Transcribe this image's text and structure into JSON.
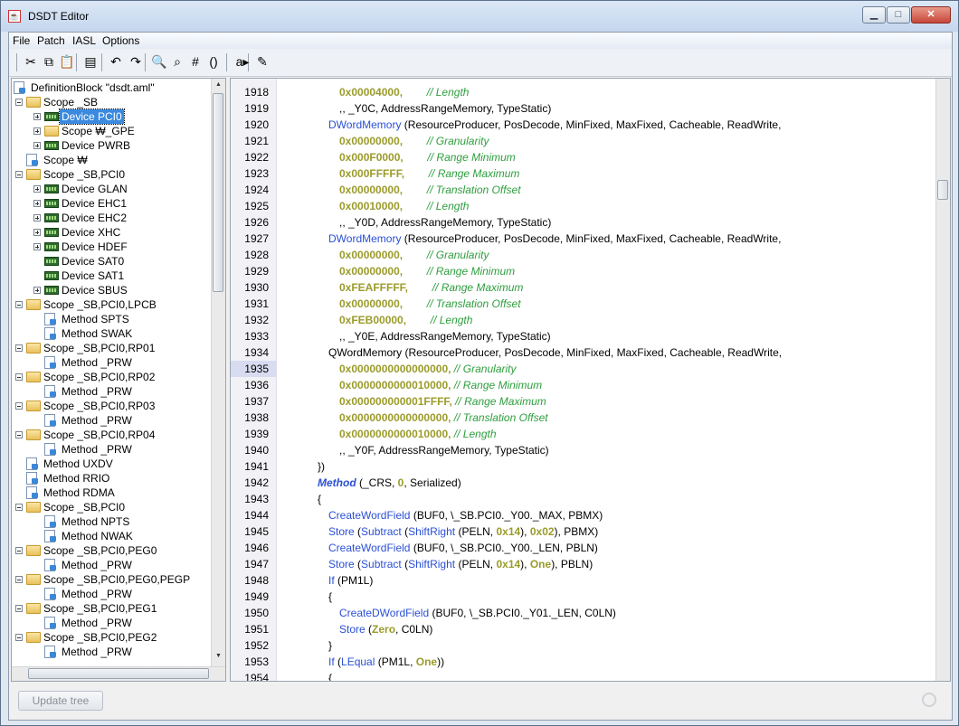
{
  "window": {
    "title": "DSDT Editor",
    "minimize": "▁",
    "maximize": "□",
    "close": "✕"
  },
  "menu": [
    "File",
    "Patch",
    "IASL",
    "Options"
  ],
  "toolbar": [
    {
      "name": "cut-icon",
      "glyph": "✂"
    },
    {
      "name": "copy-icon",
      "glyph": "⧉"
    },
    {
      "name": "paste-icon",
      "glyph": "📋"
    },
    {
      "name": "properties-icon",
      "glyph": "▤"
    },
    {
      "name": "undo-icon",
      "glyph": "↶"
    },
    {
      "name": "redo-icon",
      "glyph": "↷"
    },
    {
      "name": "find-icon",
      "glyph": "🔍"
    },
    {
      "name": "find-replace-icon",
      "glyph": "⌕"
    },
    {
      "name": "goto-line-icon",
      "glyph": "#"
    },
    {
      "name": "braces-icon",
      "glyph": "()"
    },
    {
      "name": "compile-icon",
      "glyph": "a▸"
    },
    {
      "name": "notes-icon",
      "glyph": "✎"
    }
  ],
  "tree": [
    {
      "label": "DefinitionBlock \"dsdt.aml\"",
      "depth": 0,
      "icon": "file",
      "exp": ""
    },
    {
      "label": "Scope _SB",
      "depth": 1,
      "icon": "folder",
      "exp": "minus"
    },
    {
      "label": "Device PCI0",
      "depth": 2,
      "icon": "chip",
      "exp": "plus",
      "selected": true
    },
    {
      "label": "Scope ₩_GPE",
      "depth": 2,
      "icon": "folder",
      "exp": "plus"
    },
    {
      "label": "Device PWRB",
      "depth": 2,
      "icon": "chip",
      "exp": "plus"
    },
    {
      "label": "Scope ₩",
      "depth": 1,
      "icon": "file",
      "exp": ""
    },
    {
      "label": "Scope _SB,PCI0",
      "depth": 1,
      "icon": "folder",
      "exp": "minus"
    },
    {
      "label": "Device GLAN",
      "depth": 2,
      "icon": "chip",
      "exp": "plus"
    },
    {
      "label": "Device EHC1",
      "depth": 2,
      "icon": "chip",
      "exp": "plus"
    },
    {
      "label": "Device EHC2",
      "depth": 2,
      "icon": "chip",
      "exp": "plus"
    },
    {
      "label": "Device XHC",
      "depth": 2,
      "icon": "chip",
      "exp": "plus"
    },
    {
      "label": "Device HDEF",
      "depth": 2,
      "icon": "chip",
      "exp": "plus"
    },
    {
      "label": "Device SAT0",
      "depth": 2,
      "icon": "chip",
      "exp": ""
    },
    {
      "label": "Device SAT1",
      "depth": 2,
      "icon": "chip",
      "exp": ""
    },
    {
      "label": "Device SBUS",
      "depth": 2,
      "icon": "chip",
      "exp": "plus"
    },
    {
      "label": "Scope _SB,PCI0,LPCB",
      "depth": 1,
      "icon": "folder",
      "exp": "minus"
    },
    {
      "label": "Method SPTS",
      "depth": 2,
      "icon": "file",
      "exp": ""
    },
    {
      "label": "Method SWAK",
      "depth": 2,
      "icon": "file",
      "exp": ""
    },
    {
      "label": "Scope _SB,PCI0,RP01",
      "depth": 1,
      "icon": "folder",
      "exp": "minus"
    },
    {
      "label": "Method _PRW",
      "depth": 2,
      "icon": "file",
      "exp": ""
    },
    {
      "label": "Scope _SB,PCI0,RP02",
      "depth": 1,
      "icon": "folder",
      "exp": "minus"
    },
    {
      "label": "Method _PRW",
      "depth": 2,
      "icon": "file",
      "exp": ""
    },
    {
      "label": "Scope _SB,PCI0,RP03",
      "depth": 1,
      "icon": "folder",
      "exp": "minus"
    },
    {
      "label": "Method _PRW",
      "depth": 2,
      "icon": "file",
      "exp": ""
    },
    {
      "label": "Scope _SB,PCI0,RP04",
      "depth": 1,
      "icon": "folder",
      "exp": "minus"
    },
    {
      "label": "Method _PRW",
      "depth": 2,
      "icon": "file",
      "exp": ""
    },
    {
      "label": "Method UXDV",
      "depth": 1,
      "icon": "file",
      "exp": ""
    },
    {
      "label": "Method RRIO",
      "depth": 1,
      "icon": "file",
      "exp": ""
    },
    {
      "label": "Method RDMA",
      "depth": 1,
      "icon": "file",
      "exp": ""
    },
    {
      "label": "Scope _SB,PCI0",
      "depth": 1,
      "icon": "folder",
      "exp": "minus"
    },
    {
      "label": "Method NPTS",
      "depth": 2,
      "icon": "file",
      "exp": ""
    },
    {
      "label": "Method NWAK",
      "depth": 2,
      "icon": "file",
      "exp": ""
    },
    {
      "label": "Scope _SB,PCI0,PEG0",
      "depth": 1,
      "icon": "folder",
      "exp": "minus"
    },
    {
      "label": "Method _PRW",
      "depth": 2,
      "icon": "file",
      "exp": ""
    },
    {
      "label": "Scope _SB,PCI0,PEG0,PEGP",
      "depth": 1,
      "icon": "folder",
      "exp": "minus"
    },
    {
      "label": "Method _PRW",
      "depth": 2,
      "icon": "file",
      "exp": ""
    },
    {
      "label": "Scope _SB,PCI0,PEG1",
      "depth": 1,
      "icon": "folder",
      "exp": "minus"
    },
    {
      "label": "Method _PRW",
      "depth": 2,
      "icon": "file",
      "exp": ""
    },
    {
      "label": "Scope _SB,PCI0,PEG2",
      "depth": 1,
      "icon": "folder",
      "exp": "minus"
    },
    {
      "label": "Method _PRW",
      "depth": 2,
      "icon": "file",
      "exp": ""
    }
  ],
  "editor": {
    "current_line": 1935,
    "lines": [
      {
        "n": 1918,
        "i": 2,
        "t": [
          [
            "0x00004000,",
            "num"
          ],
          [
            "        // Length",
            "com"
          ]
        ]
      },
      {
        "n": 1919,
        "i": 2,
        "t": [
          [
            ",, _Y0C, AddressRangeMemory, TypeStatic)",
            ""
          ]
        ]
      },
      {
        "n": 1920,
        "i": 1,
        "t": [
          [
            "DWordMemory",
            "kw"
          ],
          [
            " (ResourceProducer, PosDecode, MinFixed, MaxFixed, Cacheable, ReadWrite,",
            ""
          ]
        ]
      },
      {
        "n": 1921,
        "i": 2,
        "t": [
          [
            "0x00000000,",
            "num"
          ],
          [
            "        // Granularity",
            "com"
          ]
        ]
      },
      {
        "n": 1922,
        "i": 2,
        "t": [
          [
            "0x000F0000,",
            "num"
          ],
          [
            "        // Range Minimum",
            "com"
          ]
        ]
      },
      {
        "n": 1923,
        "i": 2,
        "t": [
          [
            "0x000FFFFF,",
            "num"
          ],
          [
            "        // Range Maximum",
            "com"
          ]
        ]
      },
      {
        "n": 1924,
        "i": 2,
        "t": [
          [
            "0x00000000,",
            "num"
          ],
          [
            "        // Translation Offset",
            "com"
          ]
        ]
      },
      {
        "n": 1925,
        "i": 2,
        "t": [
          [
            "0x00010000,",
            "num"
          ],
          [
            "        // Length",
            "com"
          ]
        ]
      },
      {
        "n": 1926,
        "i": 2,
        "t": [
          [
            ",, _Y0D, AddressRangeMemory, TypeStatic)",
            ""
          ]
        ]
      },
      {
        "n": 1927,
        "i": 1,
        "t": [
          [
            "DWordMemory",
            "kw"
          ],
          [
            " (ResourceProducer, PosDecode, MinFixed, MaxFixed, Cacheable, ReadWrite,",
            ""
          ]
        ]
      },
      {
        "n": 1928,
        "i": 2,
        "t": [
          [
            "0x00000000,",
            "num"
          ],
          [
            "        // Granularity",
            "com"
          ]
        ]
      },
      {
        "n": 1929,
        "i": 2,
        "t": [
          [
            "0x00000000,",
            "num"
          ],
          [
            "        // Range Minimum",
            "com"
          ]
        ]
      },
      {
        "n": 1930,
        "i": 2,
        "t": [
          [
            "0xFEAFFFFF,",
            "num"
          ],
          [
            "        // Range Maximum",
            "com"
          ]
        ]
      },
      {
        "n": 1931,
        "i": 2,
        "t": [
          [
            "0x00000000,",
            "num"
          ],
          [
            "        // Translation Offset",
            "com"
          ]
        ]
      },
      {
        "n": 1932,
        "i": 2,
        "t": [
          [
            "0xFEB00000,",
            "num"
          ],
          [
            "        // Length",
            "com"
          ]
        ]
      },
      {
        "n": 1933,
        "i": 2,
        "t": [
          [
            ",, _Y0E, AddressRangeMemory, TypeStatic)",
            ""
          ]
        ]
      },
      {
        "n": 1934,
        "i": 1,
        "t": [
          [
            "QWordMemory (ResourceProducer, PosDecode, MinFixed, MaxFixed, Cacheable, ReadWrite,",
            ""
          ]
        ]
      },
      {
        "n": 1935,
        "i": 2,
        "t": [
          [
            "0x0000000000000000,",
            "num"
          ],
          [
            " // Granularity",
            "com"
          ]
        ]
      },
      {
        "n": 1936,
        "i": 2,
        "t": [
          [
            "0x0000000000010000,",
            "num"
          ],
          [
            " // Range Minimum",
            "com"
          ]
        ]
      },
      {
        "n": 1937,
        "i": 2,
        "t": [
          [
            "0x000000000001FFFF,",
            "num"
          ],
          [
            " // Range Maximum",
            "com"
          ]
        ]
      },
      {
        "n": 1938,
        "i": 2,
        "t": [
          [
            "0x0000000000000000,",
            "num"
          ],
          [
            " // Translation Offset",
            "com"
          ]
        ]
      },
      {
        "n": 1939,
        "i": 2,
        "t": [
          [
            "0x0000000000010000,",
            "num"
          ],
          [
            " // Length",
            "com"
          ]
        ]
      },
      {
        "n": 1940,
        "i": 2,
        "t": [
          [
            ",, _Y0F, AddressRangeMemory, TypeStatic)",
            ""
          ]
        ]
      },
      {
        "n": 1941,
        "i": 0,
        "t": [
          [
            "})",
            ""
          ]
        ]
      },
      {
        "n": 1942,
        "i": 0,
        "t": [
          [
            "Method",
            "kwb"
          ],
          [
            " (_CRS, ",
            ""
          ],
          [
            "0",
            "num"
          ],
          [
            ", Serialized)",
            ""
          ]
        ]
      },
      {
        "n": 1943,
        "i": 0,
        "t": [
          [
            "{",
            ""
          ]
        ]
      },
      {
        "n": 1944,
        "i": 1,
        "t": [
          [
            "CreateWordField",
            "kw"
          ],
          [
            " (BUF0, \\_SB.PCI0._Y00._MAX, PBMX)",
            ""
          ]
        ]
      },
      {
        "n": 1945,
        "i": 1,
        "t": [
          [
            "Store",
            "kw"
          ],
          [
            " (",
            ""
          ],
          [
            "Subtract",
            "kw"
          ],
          [
            " (",
            ""
          ],
          [
            "ShiftRight",
            "kw"
          ],
          [
            " (PELN, ",
            ""
          ],
          [
            "0x14",
            "num"
          ],
          [
            "), ",
            ""
          ],
          [
            "0x02",
            "num"
          ],
          [
            "), PBMX)",
            ""
          ]
        ]
      },
      {
        "n": 1946,
        "i": 1,
        "t": [
          [
            "CreateWordField",
            "kw"
          ],
          [
            " (BUF0, \\_SB.PCI0._Y00._LEN, PBLN)",
            ""
          ]
        ]
      },
      {
        "n": 1947,
        "i": 1,
        "t": [
          [
            "Store",
            "kw"
          ],
          [
            " (",
            ""
          ],
          [
            "Subtract",
            "kw"
          ],
          [
            " (",
            ""
          ],
          [
            "ShiftRight",
            "kw"
          ],
          [
            " (PELN, ",
            ""
          ],
          [
            "0x14",
            "num"
          ],
          [
            "), ",
            ""
          ],
          [
            "One",
            "num"
          ],
          [
            "), PBLN)",
            ""
          ]
        ]
      },
      {
        "n": 1948,
        "i": 1,
        "t": [
          [
            "If",
            "kw"
          ],
          [
            " (PM1L)",
            ""
          ]
        ]
      },
      {
        "n": 1949,
        "i": 1,
        "t": [
          [
            "{",
            ""
          ]
        ]
      },
      {
        "n": 1950,
        "i": 2,
        "t": [
          [
            "CreateDWordField",
            "kw"
          ],
          [
            " (BUF0, \\_SB.PCI0._Y01._LEN, C0LN)",
            ""
          ]
        ]
      },
      {
        "n": 1951,
        "i": 2,
        "t": [
          [
            "Store",
            "kw"
          ],
          [
            " (",
            ""
          ],
          [
            "Zero",
            "num"
          ],
          [
            ", C0LN)",
            ""
          ]
        ]
      },
      {
        "n": 1952,
        "i": 1,
        "t": [
          [
            "}",
            ""
          ]
        ]
      },
      {
        "n": 1953,
        "i": 1,
        "t": [
          [
            "If",
            "kw"
          ],
          [
            " (",
            ""
          ],
          [
            "LEqual",
            "kw"
          ],
          [
            " (PM1L, ",
            ""
          ],
          [
            "One",
            "num"
          ],
          [
            "))",
            ""
          ]
        ]
      },
      {
        "n": 1954,
        "i": 1,
        "t": [
          [
            "{",
            ""
          ]
        ]
      }
    ]
  },
  "status": {
    "update_tree": "Update tree"
  },
  "colors": {
    "keyword": "#2b4fd6",
    "number": "#9b9b2b",
    "comment": "#2e9e3e",
    "selection": "#3b8ae0"
  }
}
